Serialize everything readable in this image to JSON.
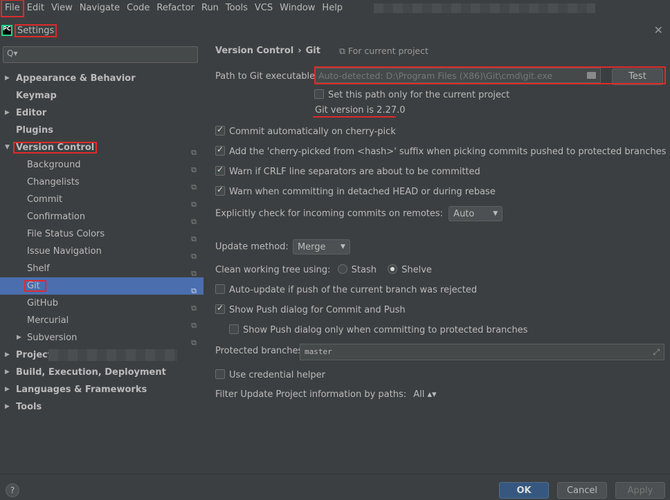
{
  "menu": [
    "File",
    "Edit",
    "View",
    "Navigate",
    "Code",
    "Refactor",
    "Run",
    "Tools",
    "VCS",
    "Window",
    "Help"
  ],
  "window": {
    "title": "Settings",
    "logo_text": "PC",
    "close": "✕"
  },
  "search": {
    "placeholder": "Q▾"
  },
  "tree": [
    {
      "label": "Appearance & Behavior",
      "level": 0,
      "expandable": true,
      "expanded": false
    },
    {
      "label": "Keymap",
      "level": 0
    },
    {
      "label": "Editor",
      "level": 0,
      "expandable": true,
      "expanded": false
    },
    {
      "label": "Plugins",
      "level": 0
    },
    {
      "label": "Version Control",
      "level": 0,
      "expandable": true,
      "expanded": true,
      "project": true,
      "highlight": true
    },
    {
      "label": "Background",
      "level": 1,
      "project": true
    },
    {
      "label": "Changelists",
      "level": 1,
      "project": true
    },
    {
      "label": "Commit",
      "level": 1,
      "project": true
    },
    {
      "label": "Confirmation",
      "level": 1,
      "project": true
    },
    {
      "label": "File Status Colors",
      "level": 1,
      "project": true
    },
    {
      "label": "Issue Navigation",
      "level": 1,
      "project": true
    },
    {
      "label": "Shelf",
      "level": 1,
      "project": true
    },
    {
      "label": "Git",
      "level": 1,
      "project": true,
      "selected": true,
      "highlight": true
    },
    {
      "label": "GitHub",
      "level": 1,
      "project": true
    },
    {
      "label": "Mercurial",
      "level": 1,
      "project": true
    },
    {
      "label": "Subversion",
      "level": 1,
      "expandable": true,
      "expanded": false,
      "project": true
    },
    {
      "label": "Project:",
      "level": 0,
      "expandable": true,
      "expanded": false,
      "blurred": true
    },
    {
      "label": "Build, Execution, Deployment",
      "level": 0,
      "expandable": true,
      "expanded": false
    },
    {
      "label": "Languages & Frameworks",
      "level": 0,
      "expandable": true,
      "expanded": false
    },
    {
      "label": "Tools",
      "level": 0,
      "expandable": true,
      "expanded": false
    }
  ],
  "breadcrumb": {
    "parent": "Version Control",
    "sep": "›",
    "current": "Git",
    "for_project": "For current project"
  },
  "git": {
    "path_label": "Path to Git executable:",
    "path_value": "Auto-detected: D:\\Program Files (X86)\\Git\\cmd\\git.exe",
    "test_button": "Test",
    "current_project_only": "Set this path only for the current project",
    "version_text": "Git version is 2.27.0"
  },
  "options": {
    "cherry_pick": "Commit automatically on cherry-pick",
    "cherry_suffix": "Add the 'cherry-picked from <hash>' suffix when picking commits pushed to protected branches",
    "crlf": "Warn if CRLF line separators are about to be committed",
    "detached": "Warn when committing in detached HEAD or during rebase",
    "incoming_label": "Explicitly check for incoming commits on remotes:",
    "incoming_value": "Auto",
    "update_label": "Update method:",
    "update_value": "Merge",
    "clean_label": "Clean working tree using:",
    "stash": "Stash",
    "shelve": "Shelve",
    "auto_update": "Auto-update if push of the current branch was rejected",
    "show_push": "Show Push dialog for Commit and Push",
    "show_push_protected": "Show Push dialog only when committing to protected branches",
    "protected_label": "Protected branches:",
    "protected_value": "master",
    "credential": "Use credential helper",
    "filter_label": "Filter Update Project information by paths:",
    "filter_value": "All ▴▾"
  },
  "footer": {
    "help": "?",
    "ok": "OK",
    "cancel": "Cancel",
    "apply": "Apply"
  },
  "colors": {
    "background": "#3c3f41",
    "selection": "#4b6eaf",
    "accent_ok": "#365880",
    "annotation": "#e02a2a"
  }
}
